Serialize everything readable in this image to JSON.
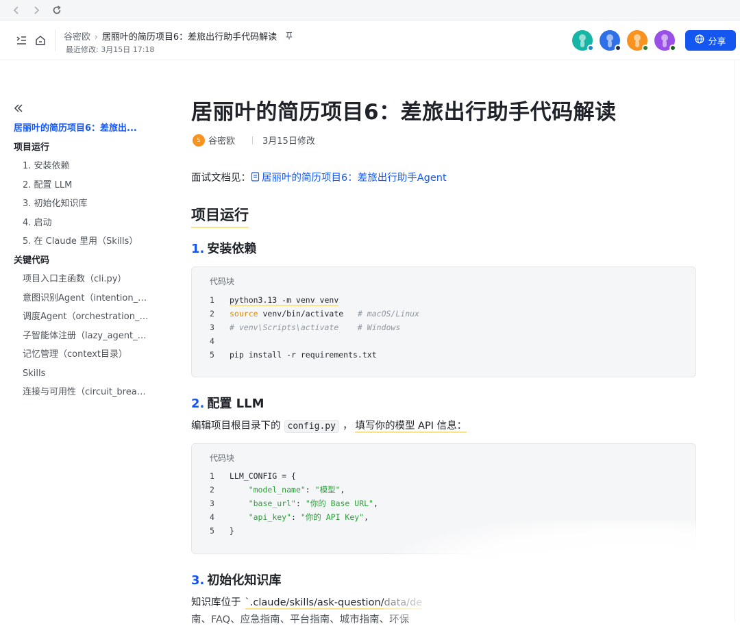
{
  "browser": {
    "back_icon": "chevron-left-icon",
    "forward_icon": "chevron-right-icon",
    "reload_icon": "reload-icon"
  },
  "header": {
    "breadcrumb_root": "谷密欧",
    "breadcrumb_current": "居丽叶的简历项目6：差旅出行助手代码解读",
    "last_modified": "最近修改: 3月15日 17:18",
    "share_label": "分享",
    "avatar_colors": [
      "#17b5a5",
      "#2f6fe8",
      "#f7931e",
      "#9a4fe8"
    ],
    "status_colors": [
      "#1b88c8",
      "#1f2a44",
      "#2e7d32",
      "#1b5e20"
    ]
  },
  "sidebar": {
    "toc": [
      {
        "text": "居丽叶的简历项目6：差旅出...",
        "level": "active"
      },
      {
        "text": "项目运行",
        "level": "h1"
      },
      {
        "text": "1. 安装依赖",
        "level": "h2"
      },
      {
        "text": "2. 配置 LLM",
        "level": "h2"
      },
      {
        "text": "3. 初始化知识库",
        "level": "h2"
      },
      {
        "text": "4. 启动",
        "level": "h2"
      },
      {
        "text": "5. 在 Claude 里用（Skills）",
        "level": "h2"
      },
      {
        "text": "关键代码",
        "level": "h1"
      },
      {
        "text": "项目入口主函数（cli.py）",
        "level": "h2"
      },
      {
        "text": "意图识别Agent（intention_age...",
        "level": "h2"
      },
      {
        "text": "调度Agent（orchestration_age...",
        "level": "h2"
      },
      {
        "text": "子智能体注册（lazy_agent_re...",
        "level": "h2"
      },
      {
        "text": "记忆管理（context目录）",
        "level": "h2"
      },
      {
        "text": "Skills",
        "level": "h2"
      },
      {
        "text": "连接与可用性（circuit_breaker...",
        "level": "h2"
      }
    ]
  },
  "doc": {
    "title": "居丽叶的简历项目6：差旅出行助手代码解读",
    "author_initial": "S",
    "author": "谷密欧",
    "modified": "3月15日修改",
    "intro_prefix": "面试文档见：",
    "intro_link": "居丽叶的简历项目6：差旅出行助手Agent",
    "section_title": "项目运行",
    "s1_num": "1.",
    "s1_title": "安装依赖",
    "code_caption": "代码块",
    "code1": [
      {
        "n": "1",
        "a": "python3.13 -m venv venv",
        "b": ""
      },
      {
        "n": "2",
        "kw": "source",
        "a": " venv/bin/activate   ",
        "c": "# macOS/Linux"
      },
      {
        "n": "3",
        "c": "# venv\\Scripts\\activate    # Windows"
      },
      {
        "n": "4"
      },
      {
        "n": "5",
        "a": "pip install -r requirements.txt"
      }
    ],
    "s2_num": "2.",
    "s2_title": "配置 LLM",
    "s2_text_a": "编辑项目根目录下的",
    "s2_code": "config.py",
    "s2_text_b": "，",
    "s2_text_c": "填写你的模型 API 信息：",
    "code2": [
      {
        "n": "1",
        "a": "LLM_CONFIG = {"
      },
      {
        "n": "2",
        "k": "\"model_name\"",
        "v": "\"模型\""
      },
      {
        "n": "3",
        "k": "\"base_url\"",
        "v": "\"你的 Base URL\""
      },
      {
        "n": "4",
        "k": "\"api_key\"",
        "v": "\"你的 API Key\""
      },
      {
        "n": "5",
        "a": "}"
      }
    ],
    "s3_num": "3.",
    "s3_title": "初始化知识库",
    "s3_text_a": "知识库位于",
    "s3_text_b": "`.claude/skills/ask-question/data/de",
    "s3_text_c": "南、FAQ、应急指南、平台指南、城市指南、环保"
  }
}
